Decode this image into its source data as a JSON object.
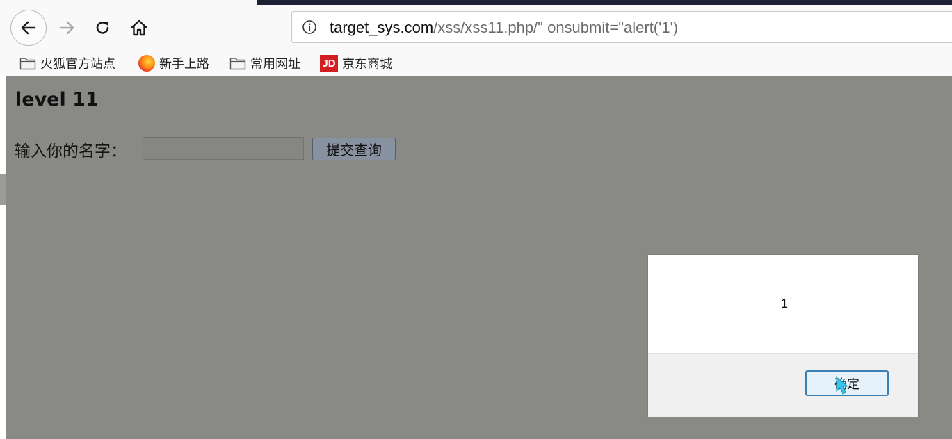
{
  "browser": {
    "url_host": "target_sys.com",
    "url_path": "/xss/xss11.php/\" onsubmit=\"alert('1')",
    "nav_icons": [
      "back-arrow-icon",
      "forward-arrow-icon",
      "reload-icon",
      "home-icon",
      "info-icon"
    ]
  },
  "bookmarks": [
    {
      "label": "火狐官方站点",
      "icon": "folder-icon"
    },
    {
      "label": "新手上路",
      "icon": "firefox-icon"
    },
    {
      "label": "常用网址",
      "icon": "folder-icon"
    },
    {
      "label": "京东商城",
      "icon": "jd-logo-icon",
      "icon_text": "JD"
    }
  ],
  "page": {
    "title": "level 11",
    "form_label": "输入你的名字：",
    "input_value": "",
    "submit_label": "提交查询"
  },
  "alert_dialog": {
    "message": "1",
    "ok_label": "确定"
  },
  "colors": {
    "overlay_background": "#898a86",
    "browser_chrome": "#f9f9fa",
    "dialog_accent": "#3c7fb1",
    "jd_red": "#d31e24"
  }
}
